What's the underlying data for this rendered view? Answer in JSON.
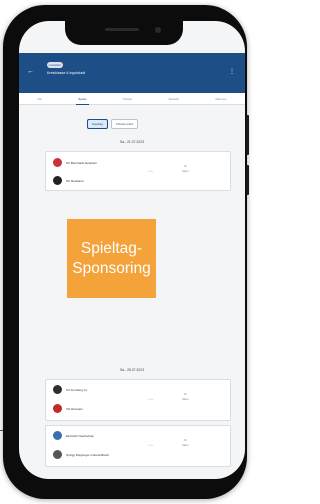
{
  "header": {
    "pill": "Liveticker",
    "title": "Kreisklasse A Ingolstadt",
    "back_icon": "back-arrow-icon",
    "menu_icon": "more-icon"
  },
  "tabs": [
    "Info",
    "Spiele",
    "Tabelle",
    "Statistik",
    "Aktionen"
  ],
  "active_tab": 1,
  "toggle": {
    "left": "Spieltag",
    "right": "Tabellenplatz"
  },
  "matchday_1": {
    "date": "Sa., 21.07.2023",
    "match": {
      "home": "SV Bernhardt-Hebstorn",
      "away": "SC Reisbach",
      "result": "- : -",
      "bell_label": "Alarm"
    }
  },
  "sponsor": {
    "line1": "Spieltag-",
    "line2": "Sponsoring"
  },
  "matchday_2": {
    "date": "Sa., 28.07.2023",
    "matches": [
      {
        "home": "SV Arnsberg (L)",
        "away": "VfL Elmstein",
        "result": "- : -",
        "bell_label": "Alarm"
      },
      {
        "home": "Eintracht Neufrechen",
        "away": "SpVgg Rüppinger-Unterwittbach",
        "result": "- : -",
        "bell_label": "Alarm"
      }
    ]
  },
  "colors": {
    "header": "#1e4e86",
    "sponsor": "#f4a23a"
  }
}
